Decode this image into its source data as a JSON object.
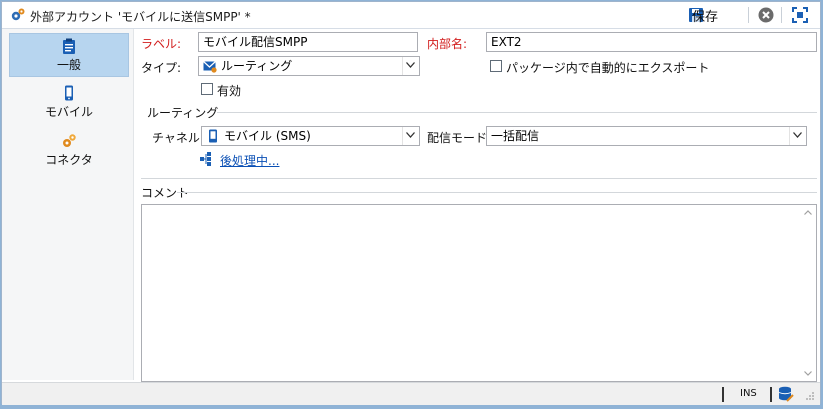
{
  "window": {
    "title": "外部アカウント 'モバイルに送信SMPP' *",
    "save_label": "保存"
  },
  "sidebar": {
    "items": [
      {
        "label": "一般",
        "icon": "clipboard-icon",
        "active": true
      },
      {
        "label": "モバイル",
        "icon": "mobile-phone-icon",
        "active": false
      },
      {
        "label": "コネクタ",
        "icon": "gears-icon",
        "active": false
      }
    ]
  },
  "form": {
    "label_caption": "ラベル:",
    "label_value": "モバイル配信SMPP",
    "internal_name_caption": "内部名:",
    "internal_name_value": "EXT2",
    "type_caption": "タイプ:",
    "type_value": "ルーティング",
    "enabled_label": "有効",
    "enabled_checked": false,
    "auto_export_label": "パッケージ内で自動的にエクスポート",
    "auto_export_checked": false
  },
  "routing": {
    "group_title": "ルーティング",
    "channel_caption": "チャネル:",
    "channel_value": "モバイル (SMS)",
    "delivery_mode_caption": "配信モード:",
    "delivery_mode_value": "一括配信",
    "post_processing_link": "後処理中..."
  },
  "comment": {
    "group_title": "コメント",
    "value": ""
  },
  "statusbar": {
    "mode": "INS"
  },
  "colors": {
    "required_label": "#d21d1d",
    "link": "#0b50b5",
    "active_tab": "#b7d5ef",
    "accent_icon": "#1a5fb4"
  }
}
